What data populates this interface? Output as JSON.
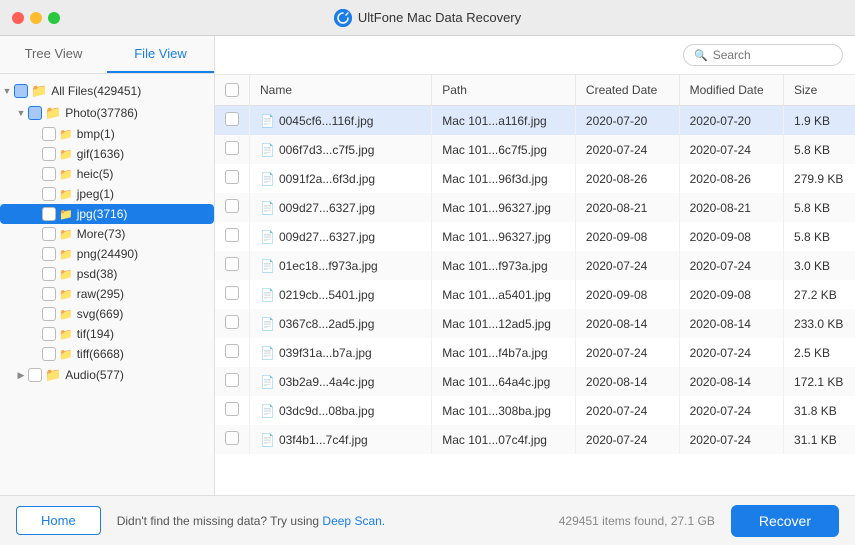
{
  "titlebar": {
    "title": "UltFone Mac Data Recovery",
    "icon_char": "U"
  },
  "tabs": {
    "tree_view": "Tree View",
    "file_view": "File View",
    "active": "file_view"
  },
  "search": {
    "placeholder": "Search"
  },
  "tree": {
    "items": [
      {
        "id": "all-files",
        "label": "All Files(429451)",
        "level": 0,
        "expanded": true,
        "type": "folder",
        "checked": "partial"
      },
      {
        "id": "photo",
        "label": "Photo(37786)",
        "level": 1,
        "expanded": true,
        "type": "folder",
        "checked": "partial"
      },
      {
        "id": "bmp",
        "label": "bmp(1)",
        "level": 2,
        "expanded": false,
        "type": "folder",
        "checked": "unchecked"
      },
      {
        "id": "gif",
        "label": "gif(1636)",
        "level": 2,
        "expanded": false,
        "type": "folder",
        "checked": "unchecked"
      },
      {
        "id": "heic",
        "label": "heic(5)",
        "level": 2,
        "expanded": false,
        "type": "folder",
        "checked": "unchecked"
      },
      {
        "id": "jpeg",
        "label": "jpeg(1)",
        "level": 2,
        "expanded": false,
        "type": "folder",
        "checked": "unchecked"
      },
      {
        "id": "jpg",
        "label": "jpg(3716)",
        "level": 2,
        "expanded": false,
        "type": "folder",
        "checked": "unchecked",
        "active": true
      },
      {
        "id": "more",
        "label": "More(73)",
        "level": 2,
        "expanded": false,
        "type": "folder",
        "checked": "unchecked"
      },
      {
        "id": "png",
        "label": "png(24490)",
        "level": 2,
        "expanded": false,
        "type": "folder",
        "checked": "unchecked"
      },
      {
        "id": "psd",
        "label": "psd(38)",
        "level": 2,
        "expanded": false,
        "type": "folder",
        "checked": "unchecked"
      },
      {
        "id": "raw",
        "label": "raw(295)",
        "level": 2,
        "expanded": false,
        "type": "folder",
        "checked": "unchecked"
      },
      {
        "id": "svg",
        "label": "svg(669)",
        "level": 2,
        "expanded": false,
        "type": "folder",
        "checked": "unchecked"
      },
      {
        "id": "tif",
        "label": "tif(194)",
        "level": 2,
        "expanded": false,
        "type": "folder",
        "checked": "unchecked"
      },
      {
        "id": "tiff",
        "label": "tiff(6668)",
        "level": 2,
        "expanded": false,
        "type": "folder",
        "checked": "unchecked"
      },
      {
        "id": "audio",
        "label": "Audio(577)",
        "level": 1,
        "expanded": false,
        "type": "folder",
        "checked": "unchecked"
      }
    ]
  },
  "table": {
    "columns": [
      "",
      "Name",
      "Path",
      "Created Date",
      "Modified Date",
      "Size"
    ],
    "rows": [
      {
        "name": "0045cf6...116f.jpg",
        "path": "Mac 101...a116f.jpg",
        "created": "2020-07-20",
        "modified": "2020-07-20",
        "size": "1.9 KB",
        "selected": true
      },
      {
        "name": "006f7d3...c7f5.jpg",
        "path": "Mac 101...6c7f5.jpg",
        "created": "2020-07-24",
        "modified": "2020-07-24",
        "size": "5.8 KB",
        "selected": false
      },
      {
        "name": "0091f2a...6f3d.jpg",
        "path": "Mac 101...96f3d.jpg",
        "created": "2020-08-26",
        "modified": "2020-08-26",
        "size": "279.9 KB",
        "selected": false
      },
      {
        "name": "009d27...6327.jpg",
        "path": "Mac 101...96327.jpg",
        "created": "2020-08-21",
        "modified": "2020-08-21",
        "size": "5.8 KB",
        "selected": false
      },
      {
        "name": "009d27...6327.jpg",
        "path": "Mac 101...96327.jpg",
        "created": "2020-09-08",
        "modified": "2020-09-08",
        "size": "5.8 KB",
        "selected": false
      },
      {
        "name": "01ec18...f973a.jpg",
        "path": "Mac 101...f973a.jpg",
        "created": "2020-07-24",
        "modified": "2020-07-24",
        "size": "3.0 KB",
        "selected": false
      },
      {
        "name": "0219cb...5401.jpg",
        "path": "Mac 101...a5401.jpg",
        "created": "2020-09-08",
        "modified": "2020-09-08",
        "size": "27.2 KB",
        "selected": false
      },
      {
        "name": "0367c8...2ad5.jpg",
        "path": "Mac 101...12ad5.jpg",
        "created": "2020-08-14",
        "modified": "2020-08-14",
        "size": "233.0 KB",
        "selected": false
      },
      {
        "name": "039f31a...b7a.jpg",
        "path": "Mac 101...f4b7a.jpg",
        "created": "2020-07-24",
        "modified": "2020-07-24",
        "size": "2.5 KB",
        "selected": false
      },
      {
        "name": "03b2a9...4a4c.jpg",
        "path": "Mac 101...64a4c.jpg",
        "created": "2020-08-14",
        "modified": "2020-08-14",
        "size": "172.1 KB",
        "selected": false
      },
      {
        "name": "03dc9d...08ba.jpg",
        "path": "Mac 101...308ba.jpg",
        "created": "2020-07-24",
        "modified": "2020-07-24",
        "size": "31.8 KB",
        "selected": false
      },
      {
        "name": "03f4b1...7c4f.jpg",
        "path": "Mac 101...07c4f.jpg",
        "created": "2020-07-24",
        "modified": "2020-07-24",
        "size": "31.1 KB",
        "selected": false
      }
    ]
  },
  "bottom_bar": {
    "home_label": "Home",
    "message_before_link": "Didn't find the missing data? Try using ",
    "deep_scan_label": "Deep Scan.",
    "message_after_link": "",
    "status_text": "429451 items found, 27.1 GB",
    "recover_label": "Recover"
  }
}
